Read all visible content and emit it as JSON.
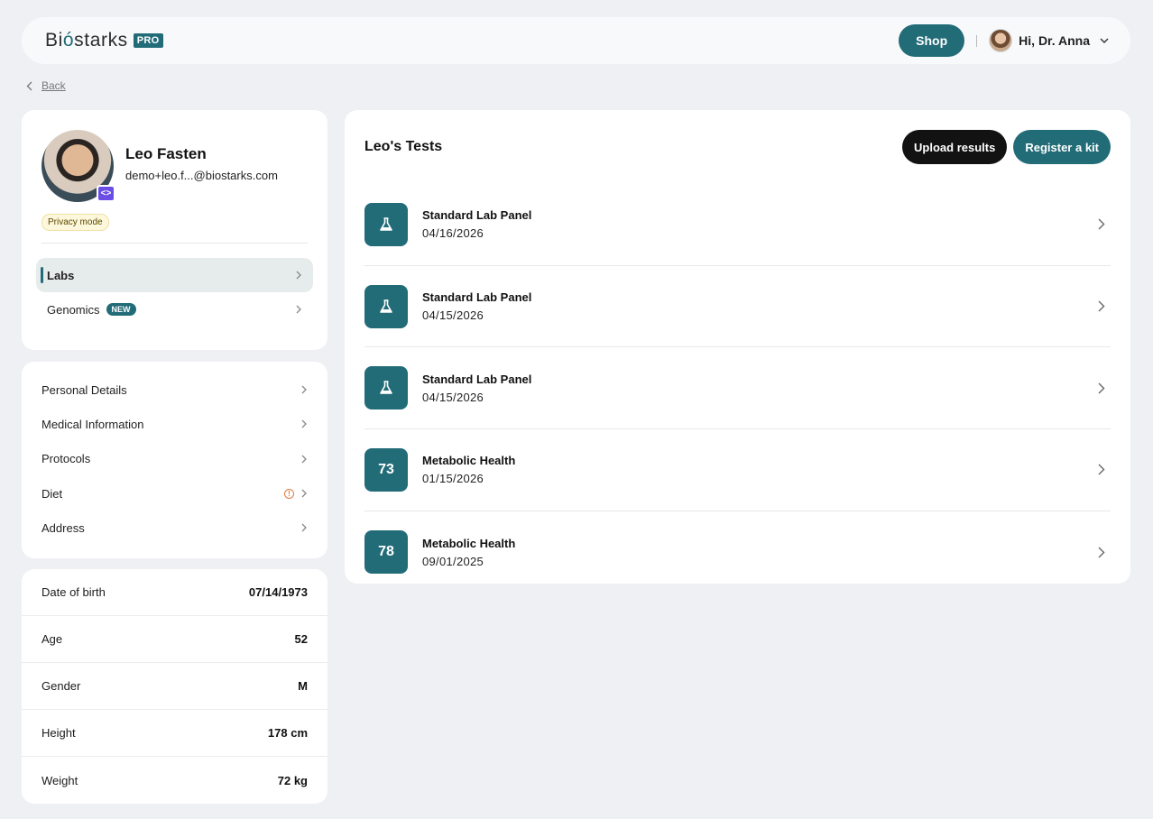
{
  "header": {
    "brand_prefix": "Bi",
    "brand_drop": "ó",
    "brand_suffix": "starks",
    "pro_badge": "PRO",
    "shop_label": "Shop",
    "separator": "|",
    "user_greeting": "Hi, Dr. Anna"
  },
  "back_label": "Back",
  "profile": {
    "name": "Leo Fasten",
    "email": "demo+leo.f...@biostarks.com",
    "privacy_badge": "Privacy mode",
    "code_badge": "<>",
    "nav": [
      {
        "label": "Labs",
        "active": true
      },
      {
        "label": "Genomics",
        "badge": "NEW"
      }
    ]
  },
  "menu": [
    {
      "label": "Personal Details"
    },
    {
      "label": "Medical Information"
    },
    {
      "label": "Protocols"
    },
    {
      "label": "Diet",
      "warning": "!"
    },
    {
      "label": "Address"
    }
  ],
  "info": [
    {
      "label": "Date of birth",
      "value": "07/14/1973"
    },
    {
      "label": "Age",
      "value": "52"
    },
    {
      "label": "Gender",
      "value": "M"
    },
    {
      "label": "Height",
      "value": "178 cm"
    },
    {
      "label": "Weight",
      "value": "72 kg"
    }
  ],
  "tests": {
    "title": "Leo's Tests",
    "upload_label": "Upload results",
    "register_label": "Register a kit",
    "items": [
      {
        "name": "Standard Lab Panel",
        "date": "04/16/2026",
        "icon": "flask-icon",
        "score": ""
      },
      {
        "name": "Standard Lab Panel",
        "date": "04/15/2026",
        "icon": "flask-icon",
        "score": ""
      },
      {
        "name": "Standard Lab Panel",
        "date": "04/15/2026",
        "icon": "flask-icon",
        "score": ""
      },
      {
        "name": "Metabolic Health",
        "date": "01/15/2026",
        "icon": "score",
        "score": "73"
      },
      {
        "name": "Metabolic Health",
        "date": "09/01/2025",
        "icon": "score",
        "score": "78"
      }
    ]
  },
  "colors": {
    "accent": "#226c78",
    "background": "#eef0f4",
    "badge_purple": "#6b4ee6",
    "warning": "#e07a3f"
  }
}
